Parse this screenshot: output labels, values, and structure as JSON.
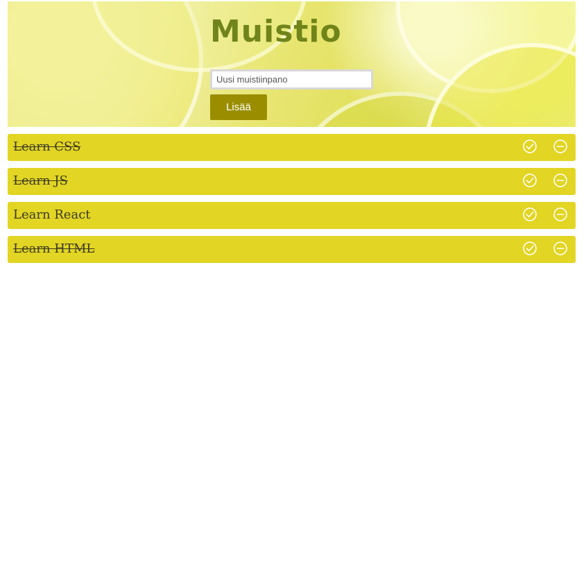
{
  "header": {
    "title": "Muistio",
    "input_placeholder": "Uusi muistiinpano",
    "input_value": "",
    "add_label": "Lisää"
  },
  "todos": [
    {
      "text": "Learn CSS",
      "done": true
    },
    {
      "text": "Learn JS",
      "done": true
    },
    {
      "text": "Learn React",
      "done": false
    },
    {
      "text": "Learn HTML",
      "done": true
    }
  ],
  "icons": {
    "complete": "check-circle-icon",
    "delete": "minus-circle-icon"
  },
  "colors": {
    "item_bg": "#e2d523",
    "button_bg": "#9a8e00",
    "title": "#6f841a"
  }
}
